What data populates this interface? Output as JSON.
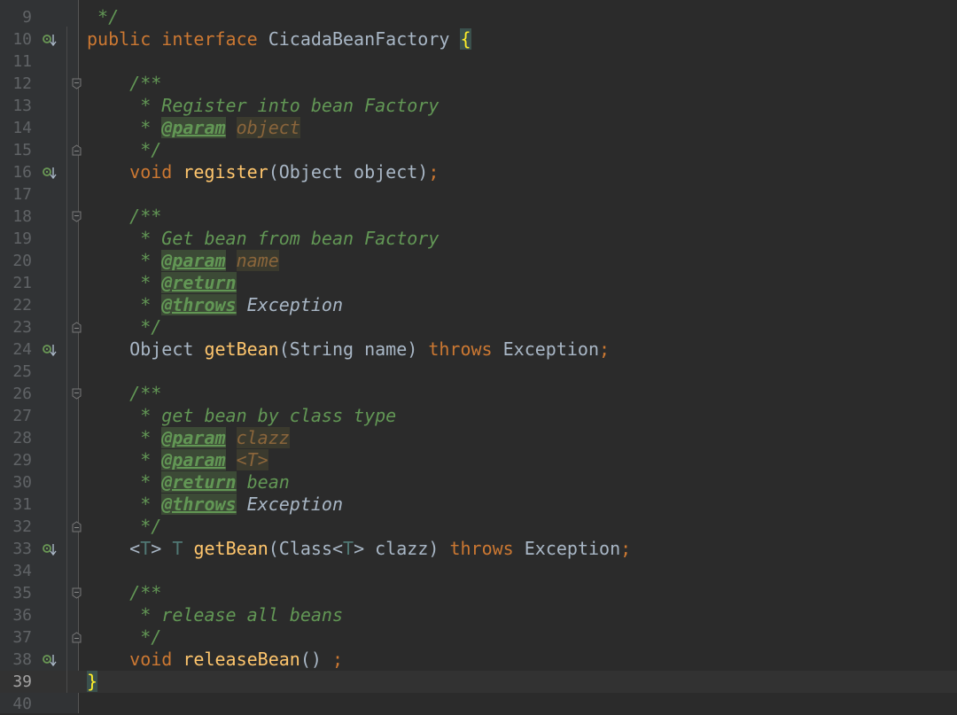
{
  "lines": [
    {
      "n": "9",
      "tokens": [
        {
          "t": " */",
          "c": "cm"
        }
      ]
    },
    {
      "n": "10",
      "icon": true,
      "tokens": [
        {
          "t": "public ",
          "c": "kw"
        },
        {
          "t": "interface ",
          "c": "kw"
        },
        {
          "t": "CicadaBeanFactory ",
          "c": "pl"
        },
        {
          "t": "{",
          "c": "brace"
        }
      ]
    },
    {
      "n": "11",
      "tokens": []
    },
    {
      "n": "12",
      "fold": "open",
      "tokens": [
        {
          "t": "    /**",
          "c": "cm"
        }
      ]
    },
    {
      "n": "13",
      "tokens": [
        {
          "t": "     * Register into bean Factory",
          "c": "cm"
        }
      ]
    },
    {
      "n": "14",
      "tokens": [
        {
          "t": "     * ",
          "c": "cm"
        },
        {
          "t": "@param",
          "c": "cmtag"
        },
        {
          "t": " ",
          "c": "cm"
        },
        {
          "t": "object",
          "c": "cmparam"
        }
      ]
    },
    {
      "n": "15",
      "fold": "close",
      "tokens": [
        {
          "t": "     */",
          "c": "cm"
        }
      ]
    },
    {
      "n": "16",
      "icon": true,
      "tokens": [
        {
          "t": "    ",
          "c": "pl"
        },
        {
          "t": "void ",
          "c": "kw"
        },
        {
          "t": "register",
          "c": "fn"
        },
        {
          "t": "(Object object)",
          "c": "pl"
        },
        {
          "t": ";",
          "c": "kw"
        }
      ]
    },
    {
      "n": "17",
      "tokens": []
    },
    {
      "n": "18",
      "fold": "open",
      "tokens": [
        {
          "t": "    /**",
          "c": "cm"
        }
      ]
    },
    {
      "n": "19",
      "tokens": [
        {
          "t": "     * Get bean from bean Factory",
          "c": "cm"
        }
      ]
    },
    {
      "n": "20",
      "tokens": [
        {
          "t": "     * ",
          "c": "cm"
        },
        {
          "t": "@param",
          "c": "cmtag"
        },
        {
          "t": " ",
          "c": "cm"
        },
        {
          "t": "name",
          "c": "cmparam"
        }
      ]
    },
    {
      "n": "21",
      "tokens": [
        {
          "t": "     * ",
          "c": "cm"
        },
        {
          "t": "@return",
          "c": "cmtag"
        }
      ]
    },
    {
      "n": "22",
      "tokens": [
        {
          "t": "     * ",
          "c": "cm"
        },
        {
          "t": "@throws",
          "c": "cmtag"
        },
        {
          "t": " ",
          "c": "cm"
        },
        {
          "t": "Exception",
          "c": "cmref"
        }
      ]
    },
    {
      "n": "23",
      "fold": "close",
      "tokens": [
        {
          "t": "     */",
          "c": "cm"
        }
      ]
    },
    {
      "n": "24",
      "icon": true,
      "tokens": [
        {
          "t": "    Object ",
          "c": "pl"
        },
        {
          "t": "getBean",
          "c": "fn"
        },
        {
          "t": "(String name) ",
          "c": "pl"
        },
        {
          "t": "throws ",
          "c": "kw"
        },
        {
          "t": "Exception",
          "c": "pl"
        },
        {
          "t": ";",
          "c": "kw"
        }
      ]
    },
    {
      "n": "25",
      "tokens": []
    },
    {
      "n": "26",
      "fold": "open",
      "tokens": [
        {
          "t": "    /**",
          "c": "cm"
        }
      ]
    },
    {
      "n": "27",
      "tokens": [
        {
          "t": "     * get bean by class type",
          "c": "cm"
        }
      ]
    },
    {
      "n": "28",
      "tokens": [
        {
          "t": "     * ",
          "c": "cm"
        },
        {
          "t": "@param",
          "c": "cmtag"
        },
        {
          "t": " ",
          "c": "cm"
        },
        {
          "t": "clazz",
          "c": "cmparam"
        }
      ]
    },
    {
      "n": "29",
      "tokens": [
        {
          "t": "     * ",
          "c": "cm"
        },
        {
          "t": "@param",
          "c": "cmtag"
        },
        {
          "t": " ",
          "c": "cm"
        },
        {
          "t": "<T>",
          "c": "cmparam"
        }
      ]
    },
    {
      "n": "30",
      "tokens": [
        {
          "t": "     * ",
          "c": "cm"
        },
        {
          "t": "@return",
          "c": "cmtag"
        },
        {
          "t": " bean",
          "c": "cm"
        }
      ]
    },
    {
      "n": "31",
      "tokens": [
        {
          "t": "     * ",
          "c": "cm"
        },
        {
          "t": "@throws",
          "c": "cmtag"
        },
        {
          "t": " ",
          "c": "cm"
        },
        {
          "t": "Exception",
          "c": "cmref"
        }
      ]
    },
    {
      "n": "32",
      "fold": "close",
      "tokens": [
        {
          "t": "     */",
          "c": "cm"
        }
      ]
    },
    {
      "n": "33",
      "icon": true,
      "tokens": [
        {
          "t": "    <",
          "c": "pl"
        },
        {
          "t": "T",
          "c": "tp"
        },
        {
          "t": "> ",
          "c": "pl"
        },
        {
          "t": "T ",
          "c": "tp"
        },
        {
          "t": "getBean",
          "c": "fn"
        },
        {
          "t": "(Class<",
          "c": "pl"
        },
        {
          "t": "T",
          "c": "tp"
        },
        {
          "t": "> clazz) ",
          "c": "pl"
        },
        {
          "t": "throws ",
          "c": "kw"
        },
        {
          "t": "Exception",
          "c": "pl"
        },
        {
          "t": ";",
          "c": "kw"
        }
      ]
    },
    {
      "n": "34",
      "tokens": []
    },
    {
      "n": "35",
      "fold": "open",
      "tokens": [
        {
          "t": "    /**",
          "c": "cm"
        }
      ]
    },
    {
      "n": "36",
      "tokens": [
        {
          "t": "     * release all beans",
          "c": "cm"
        }
      ]
    },
    {
      "n": "37",
      "fold": "close",
      "tokens": [
        {
          "t": "     */",
          "c": "cm"
        }
      ]
    },
    {
      "n": "38",
      "icon": true,
      "tokens": [
        {
          "t": "    ",
          "c": "pl"
        },
        {
          "t": "void ",
          "c": "kw"
        },
        {
          "t": "releaseBean",
          "c": "fn"
        },
        {
          "t": "() ",
          "c": "pl"
        },
        {
          "t": ";",
          "c": "kw"
        }
      ]
    },
    {
      "n": "39",
      "current": true,
      "tokens": [
        {
          "t": "}",
          "c": "brace"
        }
      ]
    },
    {
      "n": "40",
      "tokens": []
    }
  ],
  "icons": {
    "implementation": "implementation-down-arrow-icon",
    "fold": "fold-marker-icon"
  },
  "colors": {
    "background": "#2b2b2b",
    "keyword": "#cc7832",
    "method": "#ffc66d",
    "comment": "#629755",
    "plain": "#a9b7c6"
  }
}
